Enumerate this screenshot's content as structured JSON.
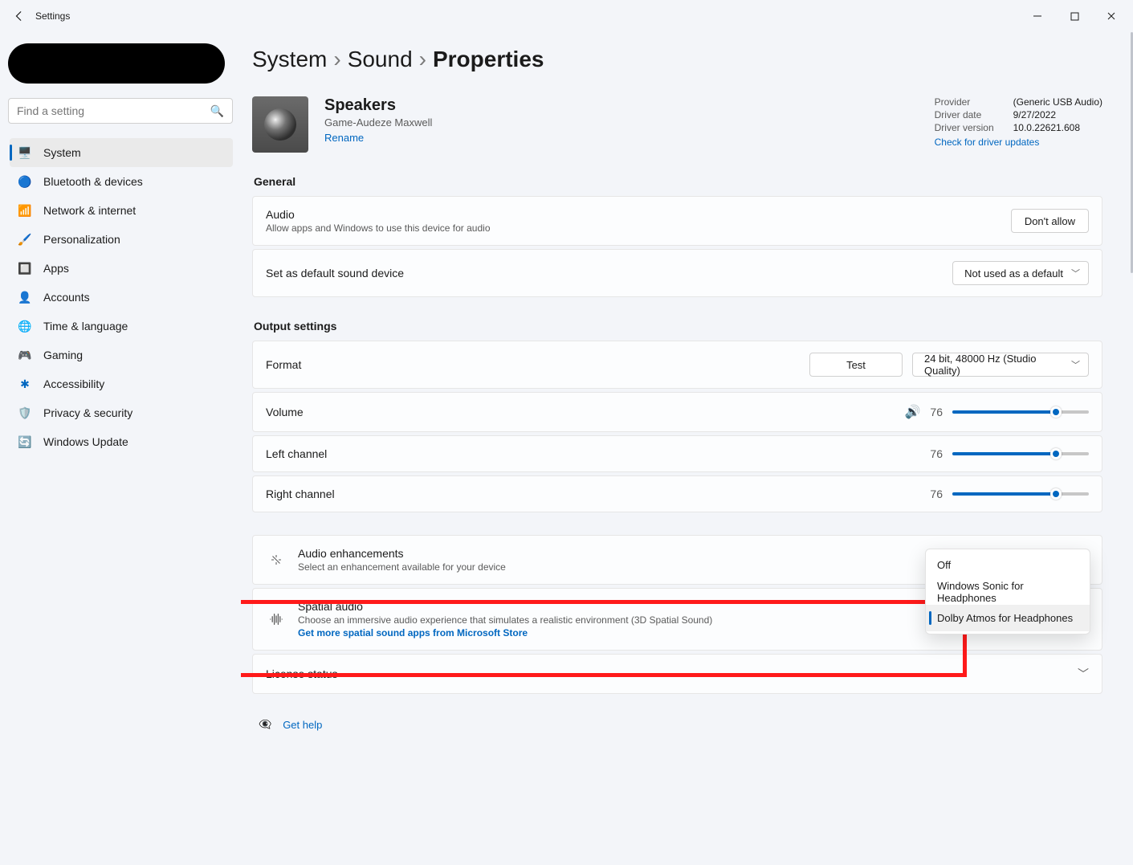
{
  "window_title": "Settings",
  "search_placeholder": "Find a setting",
  "nav": [
    {
      "label": "System"
    },
    {
      "label": "Bluetooth & devices"
    },
    {
      "label": "Network & internet"
    },
    {
      "label": "Personalization"
    },
    {
      "label": "Apps"
    },
    {
      "label": "Accounts"
    },
    {
      "label": "Time & language"
    },
    {
      "label": "Gaming"
    },
    {
      "label": "Accessibility"
    },
    {
      "label": "Privacy & security"
    },
    {
      "label": "Windows Update"
    }
  ],
  "breadcrumb": {
    "a": "System",
    "b": "Sound",
    "c": "Properties",
    "sep": "›"
  },
  "device": {
    "name": "Speakers",
    "sub": "Game-Audeze Maxwell",
    "rename": "Rename"
  },
  "driver": {
    "provider_k": "Provider",
    "provider_v": "(Generic USB Audio)",
    "date_k": "Driver date",
    "date_v": "9/27/2022",
    "ver_k": "Driver version",
    "ver_v": "10.0.22621.608",
    "check": "Check for driver updates"
  },
  "sections": {
    "general": "General",
    "output": "Output settings"
  },
  "cards": {
    "audio": {
      "title": "Audio",
      "sub": "Allow apps and Windows to use this device for audio",
      "btn": "Don't allow"
    },
    "default": {
      "title": "Set as default sound device",
      "dd": "Not used as a default"
    },
    "format": {
      "title": "Format",
      "test": "Test",
      "dd": "24 bit, 48000 Hz (Studio Quality)"
    },
    "volume": {
      "title": "Volume",
      "value": "76"
    },
    "left": {
      "title": "Left channel",
      "value": "76"
    },
    "right": {
      "title": "Right channel",
      "value": "76"
    },
    "enh": {
      "title": "Audio enhancements",
      "sub": "Select an enhancement available for your device"
    },
    "spatial": {
      "title": "Spatial audio",
      "sub": "Choose an immersive audio experience that simulates a realistic environment (3D Spatial Sound)",
      "link": "Get more spatial sound apps from Microsoft Store"
    },
    "license": {
      "title": "License status"
    }
  },
  "popup": {
    "opt0": "Off",
    "opt1": "Windows Sonic for Headphones",
    "opt2": "Dolby Atmos for Headphones"
  },
  "gethelp": "Get help"
}
